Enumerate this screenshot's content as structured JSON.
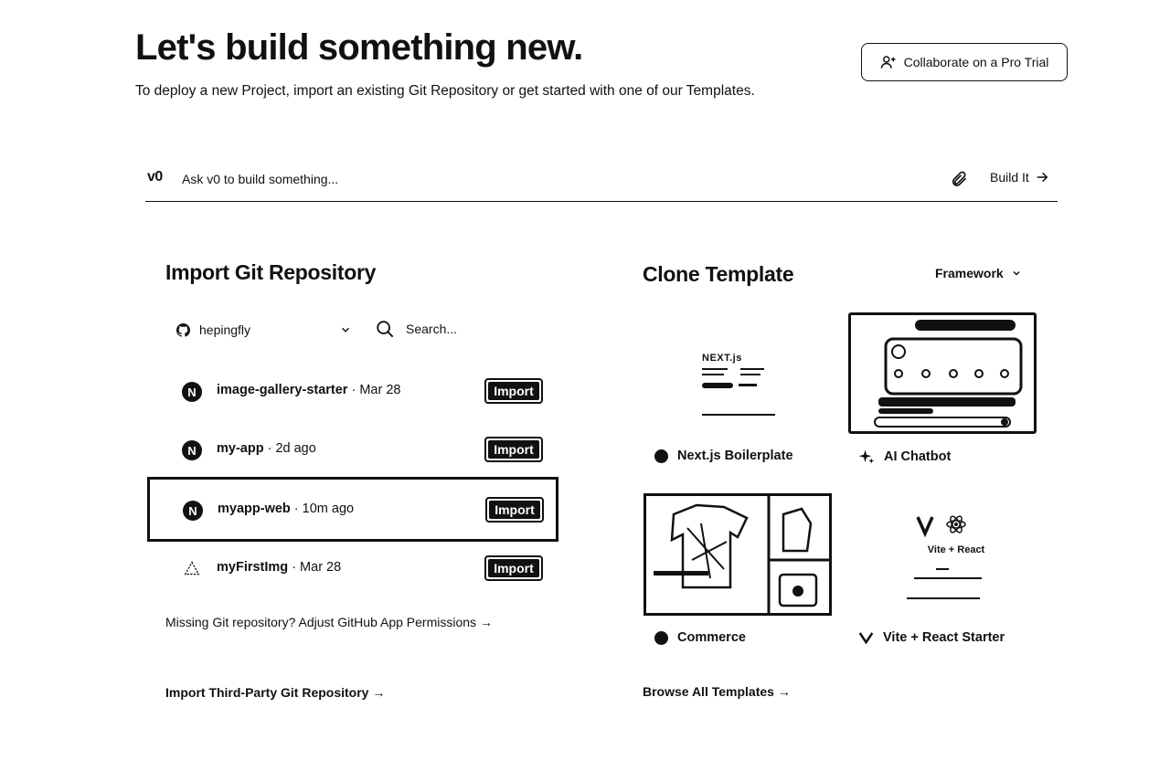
{
  "header": {
    "title": "Let's build something new.",
    "subtitle": "To deploy a new Project, import an existing Git Repository or get started with one of our Templates.",
    "collab_label": "Collaborate on a Pro Trial"
  },
  "v0": {
    "logo": "v0",
    "placeholder": "Ask v0 to build something...",
    "build_label": "Build It"
  },
  "import_section": {
    "title": "Import Git Repository",
    "account": "hepingfly",
    "search_placeholder": "Search...",
    "repos": [
      {
        "name": "image-gallery-starter",
        "meta": " · Mar 28",
        "icon": "N",
        "button": "Import"
      },
      {
        "name": "my-app",
        "meta": " · 2d ago",
        "icon": "N",
        "button": "Import"
      },
      {
        "name": "myapp-web",
        "meta": " · 10m ago",
        "icon": "N",
        "button": "Import"
      },
      {
        "name": "myFirstImg",
        "meta": " · Mar 28",
        "icon": "triangle",
        "button": "Import"
      }
    ],
    "missing_link": "Missing Git repository? Adjust GitHub App Permissions →",
    "third_party_link": "Import Third-Party Git Repository →"
  },
  "clone_section": {
    "title": "Clone Template",
    "framework_label": "Framework",
    "templates": [
      {
        "label": "Next.js Boilerplate",
        "icon": "nextjs-icon"
      },
      {
        "label": "AI Chatbot",
        "icon": "sparkles-icon"
      },
      {
        "label": "Commerce",
        "icon": "shop-icon"
      },
      {
        "label": "Vite + React Starter",
        "icon": "vite-icon"
      }
    ],
    "vite_thumb_title": "Vite + React",
    "browse_link": "Browse All Templates →"
  },
  "thumbs": {
    "next_brand": "NEXT.js"
  }
}
